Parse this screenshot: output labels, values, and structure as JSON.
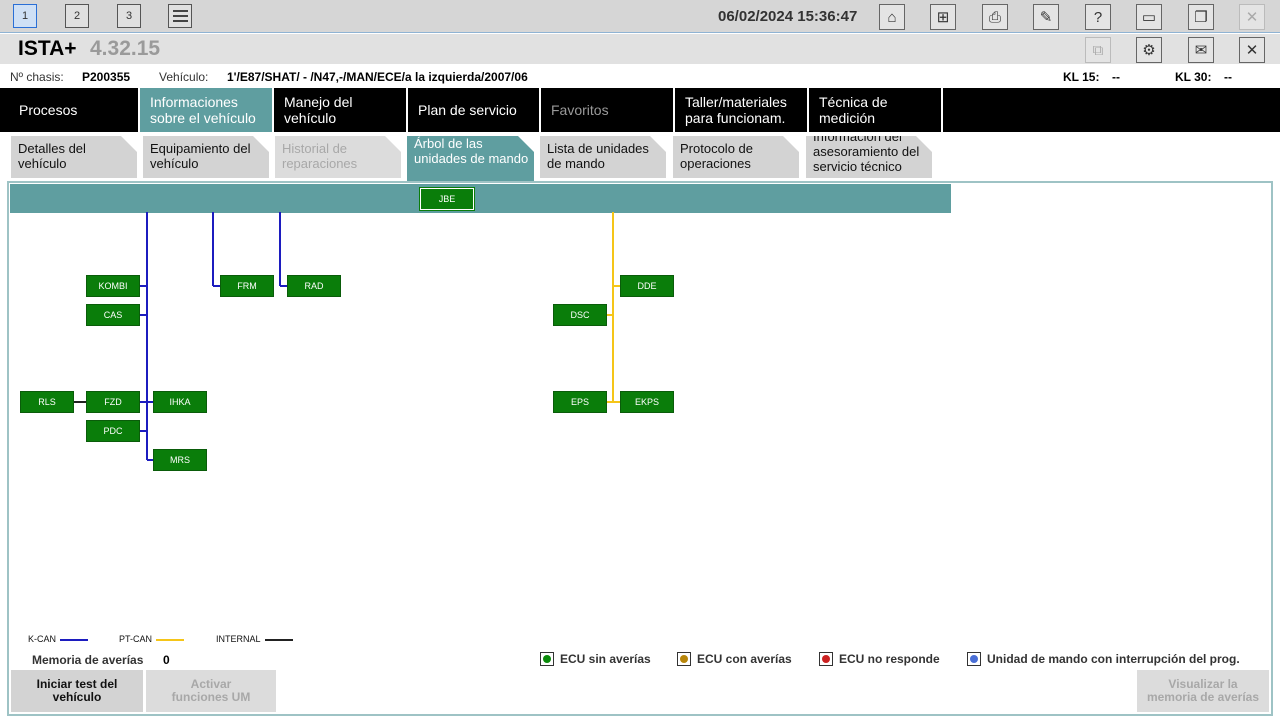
{
  "toolbar": {
    "windows": [
      "1",
      "2",
      "3"
    ],
    "datetime": "06/02/2024 15:36:47"
  },
  "app": {
    "title": "ISTA+",
    "version": "4.32.15"
  },
  "vehicle_info": {
    "chassis_label": "Nº chasis:",
    "chassis_value": "P200355",
    "vehicle_label": "Vehículo:",
    "vehicle_value": "1'/E87/SHAT/ - /N47,-/MAN/ECE/a la izquierda/2007/06",
    "kl15_label": "KL 15:",
    "kl15_value": "--",
    "kl30_label": "KL 30:",
    "kl30_value": "--"
  },
  "main_menu": [
    "Procesos",
    "Informaciones sobre el vehículo",
    "Manejo del vehículo",
    "Plan de servicio",
    "Favoritos",
    "Taller/materiales para funcionam.",
    "Técnica de medición"
  ],
  "sub_tabs": [
    "Detalles del vehículo",
    "Equipamiento del vehículo",
    "Historial de reparaciones",
    "Árbol de las unidades de mando",
    "Lista de unidades de mando",
    "Protocolo de operaciones",
    "Información del asesoramiento del servicio técnico"
  ],
  "ecus": {
    "jbe": "JBE",
    "kombi": "KOMBI",
    "cas": "CAS",
    "frm": "FRM",
    "rad": "RAD",
    "rls": "RLS",
    "fzd": "FZD",
    "ihka": "IHKA",
    "pdc": "PDC",
    "mrs": "MRS",
    "dde": "DDE",
    "dsc": "DSC",
    "eps": "EPS",
    "ekps": "EKPS"
  },
  "bus_legend": [
    {
      "label": "K-CAN",
      "color": "#1c1cbf"
    },
    {
      "label": "PT-CAN",
      "color": "#f5c518"
    },
    {
      "label": "INTERNAL",
      "color": "#222222"
    }
  ],
  "fault_memory": {
    "label": "Memoria de averías",
    "count": "0"
  },
  "status_legend": [
    {
      "label": "ECU sin averías",
      "color": "#0a8a0a"
    },
    {
      "label": "ECU con averías",
      "color": "#b8860b"
    },
    {
      "label": "ECU no responde",
      "color": "#cc2222"
    },
    {
      "label": "Unidad de mando con interrupción del prog.",
      "color": "#4a6fd6"
    }
  ],
  "buttons": {
    "start_test": "Iniciar test del vehículo",
    "activate_functions": "Activar funciones UM",
    "view_fault_memory": "Visualizar la memoria de averías"
  }
}
